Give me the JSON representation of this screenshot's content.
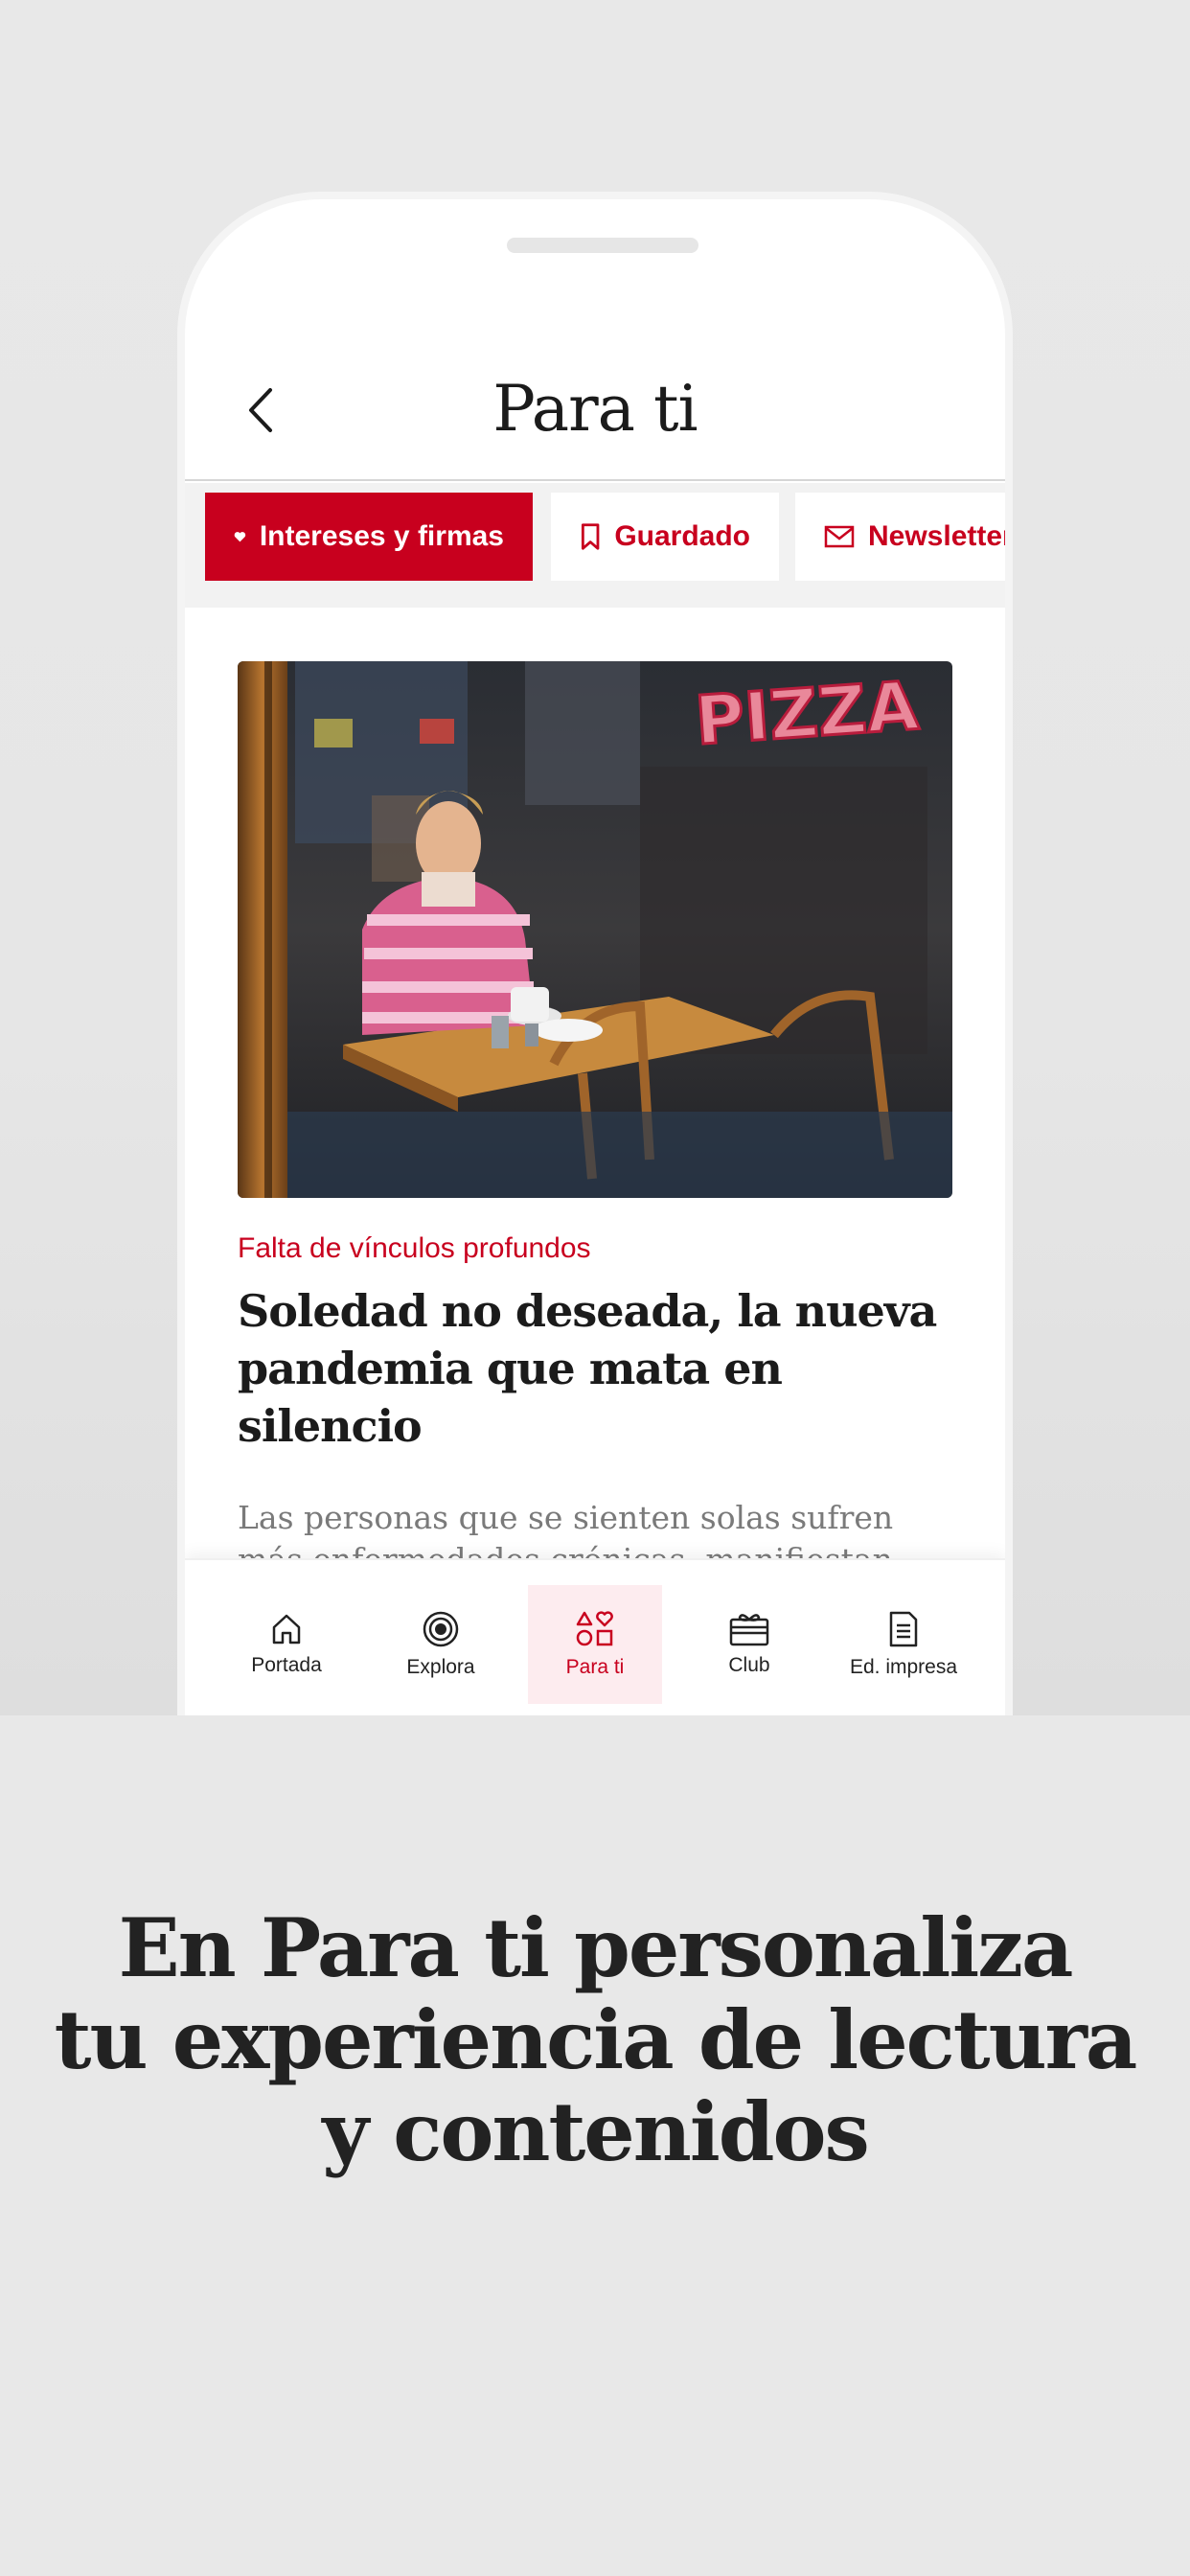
{
  "screen": {
    "title": "Para ti",
    "back_icon": "chevron-left-icon"
  },
  "tabs": [
    {
      "label": "Intereses y firmas",
      "icon": "heart-icon",
      "active": true
    },
    {
      "label": "Guardado",
      "icon": "bookmark-icon",
      "active": false
    },
    {
      "label": "Newsletter",
      "icon": "mail-icon",
      "active": false
    }
  ],
  "article": {
    "image_alt": "PIZZA",
    "kicker": "Falta de vínculos profundos",
    "headline": "Soledad no deseada, la nueva pandemia que mata en silencio",
    "summary": "Las personas que se sienten solas sufren más enfermedades crónicas, manifiestan más síntomas depresivos y ansiedad, una menor"
  },
  "bottom_nav": [
    {
      "label": "Portada",
      "icon": "home-icon",
      "active": false
    },
    {
      "label": "Explora",
      "icon": "target-icon",
      "active": false
    },
    {
      "label": "Para ti",
      "icon": "shapes-icon",
      "active": true
    },
    {
      "label": "Club",
      "icon": "gift-card-icon",
      "active": false
    },
    {
      "label": "Ed. impresa",
      "icon": "document-icon",
      "active": false
    }
  ],
  "caption": {
    "line1": "En Para ti personaliza",
    "line2": "tu experiencia de lectura",
    "line3": "y contenidos"
  },
  "colors": {
    "accent": "#c8001e",
    "background": "#e8e8e8",
    "text": "#1b1b1b"
  }
}
